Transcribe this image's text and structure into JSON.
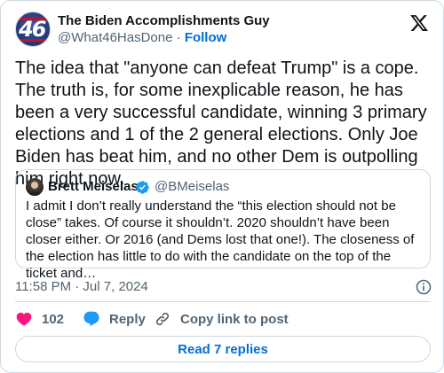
{
  "author": {
    "display_name": "The Biden Accomplishments Guy",
    "handle": "@What46HasDone",
    "separator": " · ",
    "follow_label": "Follow",
    "avatar_text": "46"
  },
  "tweet": {
    "text": "The idea that \"anyone can defeat Trump\" is a cope. The truth is, for some inexplicable reason, he has been a very successful candidate, winning 3 primary elections and 1 of the 2 general elections. Only Joe Biden has beat him, and no other Dem is outpolling him right now.",
    "timestamp": "11:58 PM · Jul 7, 2024"
  },
  "quoted_tweet": {
    "display_name": "Brett Meiselas",
    "handle": "@BMeiselas",
    "verified": true,
    "text": "I admit I don’t really understand the “this election should not be close” takes. Of course it shouldn’t. 2020 shouldn’t have been closer either. Or 2016 (and Dems lost that one!). The closeness of the election has little to do with the candidate on the top of the ticket and…"
  },
  "actions": {
    "like_count": "102",
    "reply_label": "Reply",
    "copy_label": "Copy link to post"
  },
  "read_replies_label": "Read 7 replies",
  "icons": {
    "logo": "x-logo-icon",
    "info": "info-icon",
    "like": "heart-icon",
    "reply": "reply-bubble-icon",
    "copy": "link-icon",
    "verified": "verified-badge-icon"
  },
  "colors": {
    "text": "#0f1419",
    "secondary": "#536471",
    "accent": "#006fd6",
    "like": "#f91880",
    "reply": "#1d9bf0",
    "border": "#cfd9de"
  }
}
